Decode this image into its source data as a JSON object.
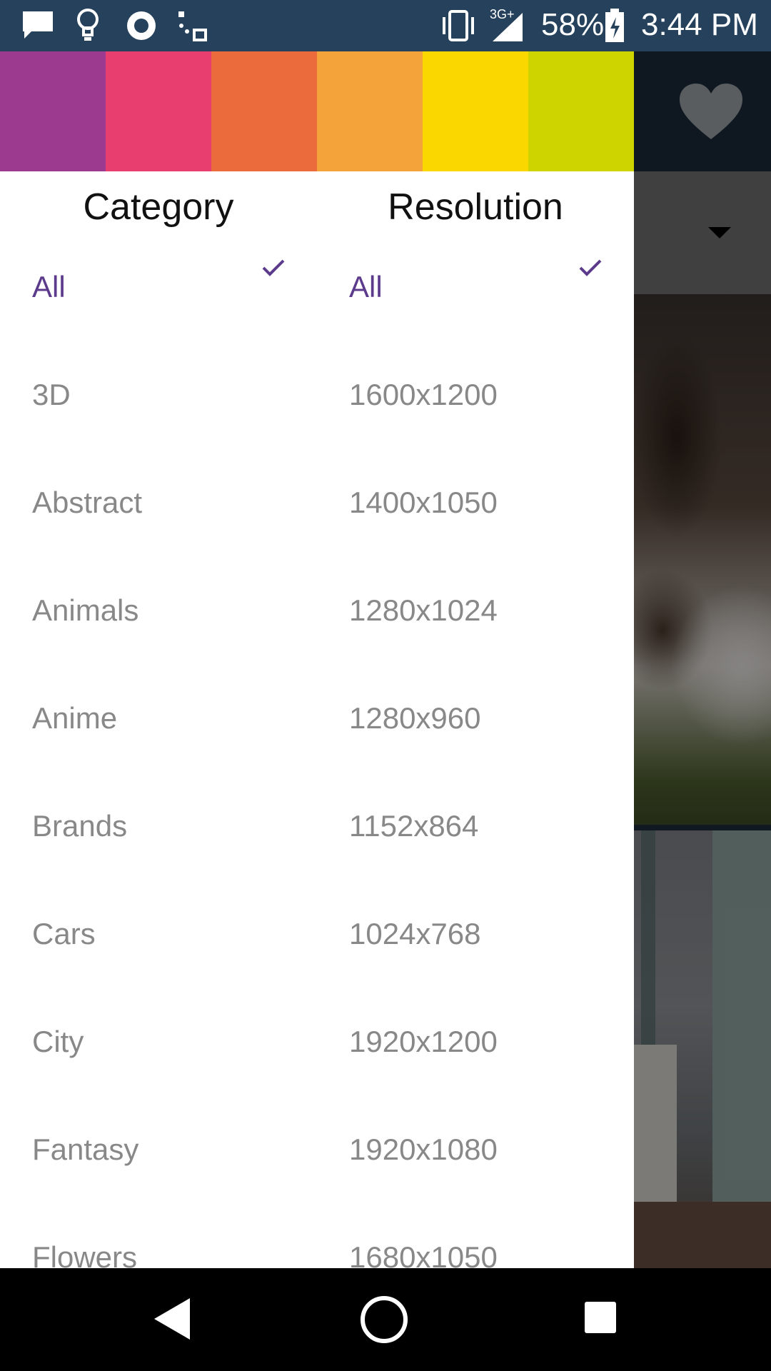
{
  "status_bar": {
    "battery_percent": "58%",
    "time": "3:44 PM",
    "network": "3G+",
    "icons": [
      "message-icon",
      "lightbulb-icon",
      "record-icon",
      "cast-icon",
      "vibrate-icon",
      "signal-icon",
      "battery-charging-icon"
    ]
  },
  "drawer": {
    "colors": [
      "#9b3a8e",
      "#e83e6f",
      "#ec6b3c",
      "#f4a23a",
      "#fbd700",
      "#cdd400"
    ],
    "category": {
      "header": "Category",
      "items": [
        {
          "label": "All",
          "selected": true
        },
        {
          "label": "3D"
        },
        {
          "label": "Abstract"
        },
        {
          "label": "Animals"
        },
        {
          "label": "Anime"
        },
        {
          "label": "Brands"
        },
        {
          "label": "Cars"
        },
        {
          "label": "City"
        },
        {
          "label": "Fantasy"
        },
        {
          "label": "Flowers"
        }
      ]
    },
    "resolution": {
      "header": "Resolution",
      "items": [
        {
          "label": "All",
          "selected": true
        },
        {
          "label": "1600x1200"
        },
        {
          "label": "1400x1050"
        },
        {
          "label": "1280x1024"
        },
        {
          "label": "1280x960"
        },
        {
          "label": "1152x864"
        },
        {
          "label": "1024x768"
        },
        {
          "label": "1920x1200"
        },
        {
          "label": "1920x1080"
        },
        {
          "label": "1680x1050"
        }
      ]
    }
  },
  "background_app": {
    "favorite_icon": "heart-icon",
    "dropdown_icon": "dropdown-arrow-icon"
  },
  "nav_bar": {
    "icons": [
      "back-icon",
      "home-icon",
      "recents-icon"
    ]
  }
}
